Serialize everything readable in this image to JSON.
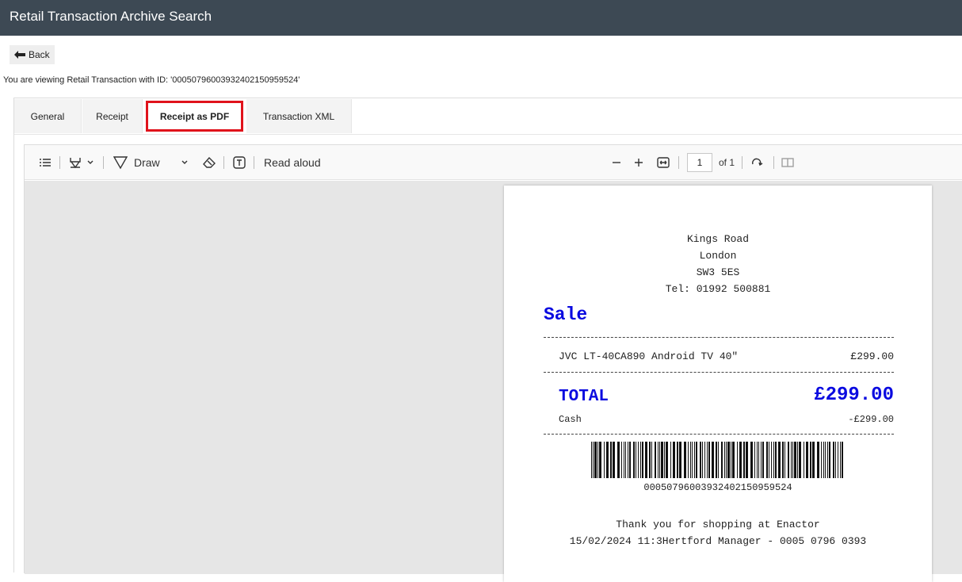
{
  "window": {
    "title": "Retail Transaction Archive Search"
  },
  "nav": {
    "back_label": "Back"
  },
  "info": {
    "viewing_text": "You are viewing Retail Transaction with ID: '000507960039324021509595​24'"
  },
  "tabs": [
    {
      "label": "General",
      "active": false
    },
    {
      "label": "Receipt",
      "active": false
    },
    {
      "label": "Receipt as PDF",
      "active": true
    },
    {
      "label": "Transaction XML",
      "active": false
    }
  ],
  "pdf_toolbar": {
    "draw_label": "Draw",
    "read_aloud_label": "Read aloud",
    "page_number": "1",
    "page_total": "of 1"
  },
  "receipt": {
    "address": [
      "Kings Road",
      "London",
      "SW3 5ES",
      "Tel: 01992 500881"
    ],
    "heading": "Sale",
    "item_name": "JVC LT-40CA890 Android TV 40\"",
    "item_price": "£299.00",
    "total_label": "TOTAL",
    "total_value": "£299.00",
    "tender_label": "Cash",
    "tender_value": "-£299.00",
    "barcode_number": "000507960039324021509595​24",
    "thanks": "Thank you for shopping at Enactor",
    "footer": "15/02/2024 11:3Hertford Manager - 0005 0796 0393"
  },
  "colors": {
    "titlebar": "#3d4954",
    "accent_red": "#e0121b",
    "receipt_blue": "#0a0ae0"
  }
}
